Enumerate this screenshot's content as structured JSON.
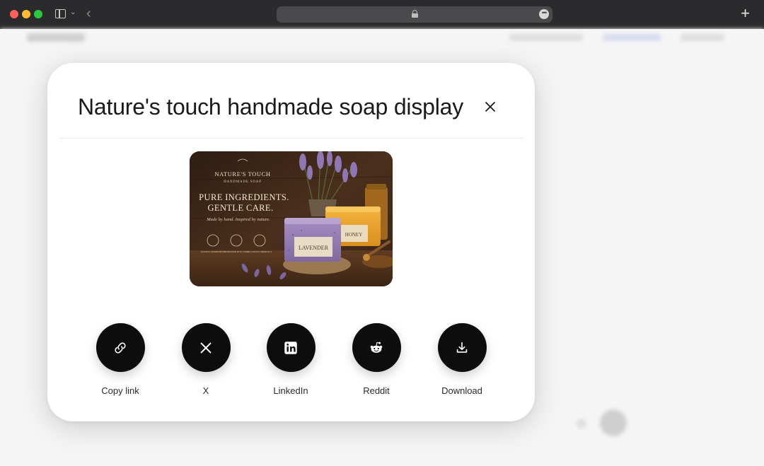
{
  "browser": {
    "new_tab_label": "+"
  },
  "modal": {
    "title": "Nature's touch handmade soap display",
    "preview": {
      "brand": "NATURE'S TOUCH",
      "brand_sub": "HANDMADE SOAP",
      "headline_1": "PURE INGREDIENTS.",
      "headline_2": "GENTLE CARE.",
      "tagline": "Made by hand. Inspired by nature.",
      "badge_1": "NATURAL INGREDIENTS",
      "badge_2": "HANDMADE WITH CARE",
      "badge_3": "NO HARSH CHEMICALS",
      "bar_1": "LAVENDER",
      "bar_2": "HONEY"
    },
    "share_options": [
      {
        "label": "Copy link",
        "icon": "link-icon"
      },
      {
        "label": "X",
        "icon": "x-logo-icon"
      },
      {
        "label": "LinkedIn",
        "icon": "linkedin-icon"
      },
      {
        "label": "Reddit",
        "icon": "reddit-icon"
      },
      {
        "label": "Download",
        "icon": "download-icon"
      }
    ]
  },
  "colors": {
    "chrome": "#2b2b2d",
    "share_button": "#0d0d0d",
    "modal_bg": "#ffffff"
  }
}
